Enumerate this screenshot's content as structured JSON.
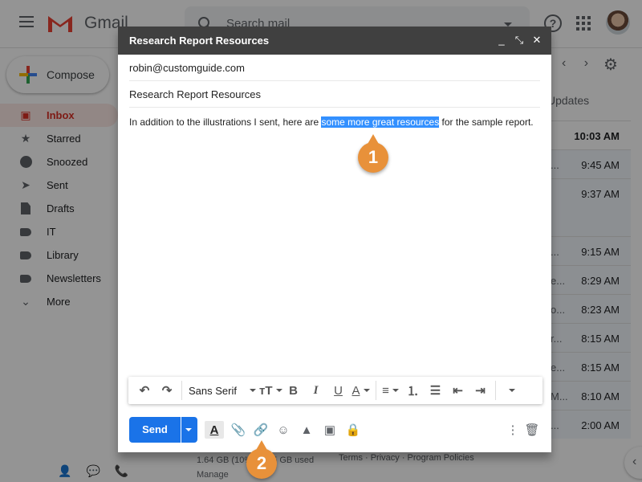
{
  "app": {
    "name": "Gmail",
    "search_placeholder": "Search mail",
    "compose_label": "Compose"
  },
  "sidebar": {
    "items": [
      {
        "label": "Inbox",
        "icon": "inbox-icon",
        "active": true
      },
      {
        "label": "Starred",
        "icon": "star-icon"
      },
      {
        "label": "Snoozed",
        "icon": "clock-icon"
      },
      {
        "label": "Sent",
        "icon": "send-icon"
      },
      {
        "label": "Drafts",
        "icon": "draft-icon"
      },
      {
        "label": "IT",
        "icon": "label-icon"
      },
      {
        "label": "Library",
        "icon": "label-icon"
      },
      {
        "label": "Newsletters",
        "icon": "label-icon"
      },
      {
        "label": "More",
        "icon": "chevron-down-icon"
      }
    ]
  },
  "inbox": {
    "tab": "Updates",
    "rows": [
      {
        "pre": "",
        "time": "10:03 AM",
        "unread": true
      },
      {
        "pre": "...",
        "time": "9:45 AM"
      },
      {
        "pre": "",
        "time": "9:37 AM"
      },
      {
        "pre": "",
        "time": ""
      },
      {
        "pre": "...",
        "time": "9:15 AM"
      },
      {
        "pre": "e...",
        "time": "8:29 AM"
      },
      {
        "pre": "o...",
        "time": "8:23 AM"
      },
      {
        "pre": "r...",
        "time": "8:15 AM"
      },
      {
        "pre": "e...",
        "time": "8:15 AM"
      },
      {
        "pre": "M...",
        "time": "8:10 AM"
      },
      {
        "pre": "...",
        "time": "2:00 AM"
      }
    ]
  },
  "footer": {
    "storage": "1.64 GB (10%) of 15 GB used",
    "manage": "Manage",
    "links": "Terms · Privacy · Program Policies"
  },
  "compose": {
    "title": "Research Report Resources",
    "to": "robin@customguide.com",
    "subject": "Research Report Resources",
    "body_before": "In addition to the illustrations I sent, here are ",
    "body_selected": "some more great resources",
    "body_after": " for the sample report.",
    "font": "Sans Serif",
    "send_label": "Send"
  },
  "callouts": {
    "one": "1",
    "two": "2"
  }
}
